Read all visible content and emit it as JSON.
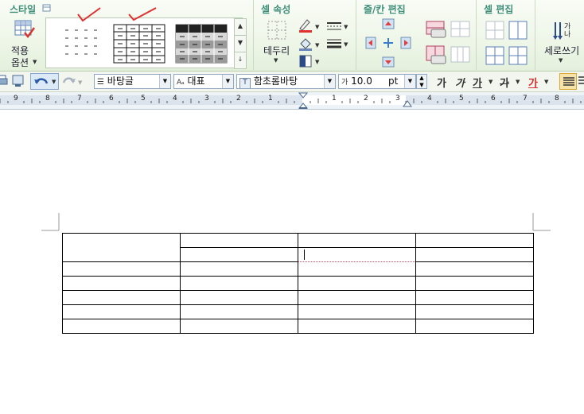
{
  "ribbon": {
    "groups": {
      "style": "스타일",
      "cell_props": "셀 속성",
      "row_col_edit": "줄/칸 편집",
      "cell_edit": "셀 편집"
    },
    "apply_label_1": "적용",
    "apply_label_2": "옵션",
    "border_label": "테두리",
    "vertical_text_label": "세로쓰기"
  },
  "format_bar": {
    "style_name": "바탕글",
    "font_lang": "대표",
    "font_name": "함초롬바탕",
    "font_size": "10.0",
    "size_unit": "pt",
    "bold_label": "가",
    "italic_label": "가",
    "underline_label": "가",
    "strike_label": "가",
    "color_label": "가"
  },
  "ruler": {
    "numbers": [
      "9",
      "8",
      "7",
      "6",
      "5",
      "4",
      "3",
      "2",
      "1",
      "1",
      "2",
      "3",
      "4",
      "5",
      "6",
      "7",
      "8"
    ]
  },
  "colors": {
    "ribbon_title": "#3f8f7a",
    "check_mark": "#e03030",
    "table_border": "#000000",
    "selection_border": "#e0405a"
  }
}
